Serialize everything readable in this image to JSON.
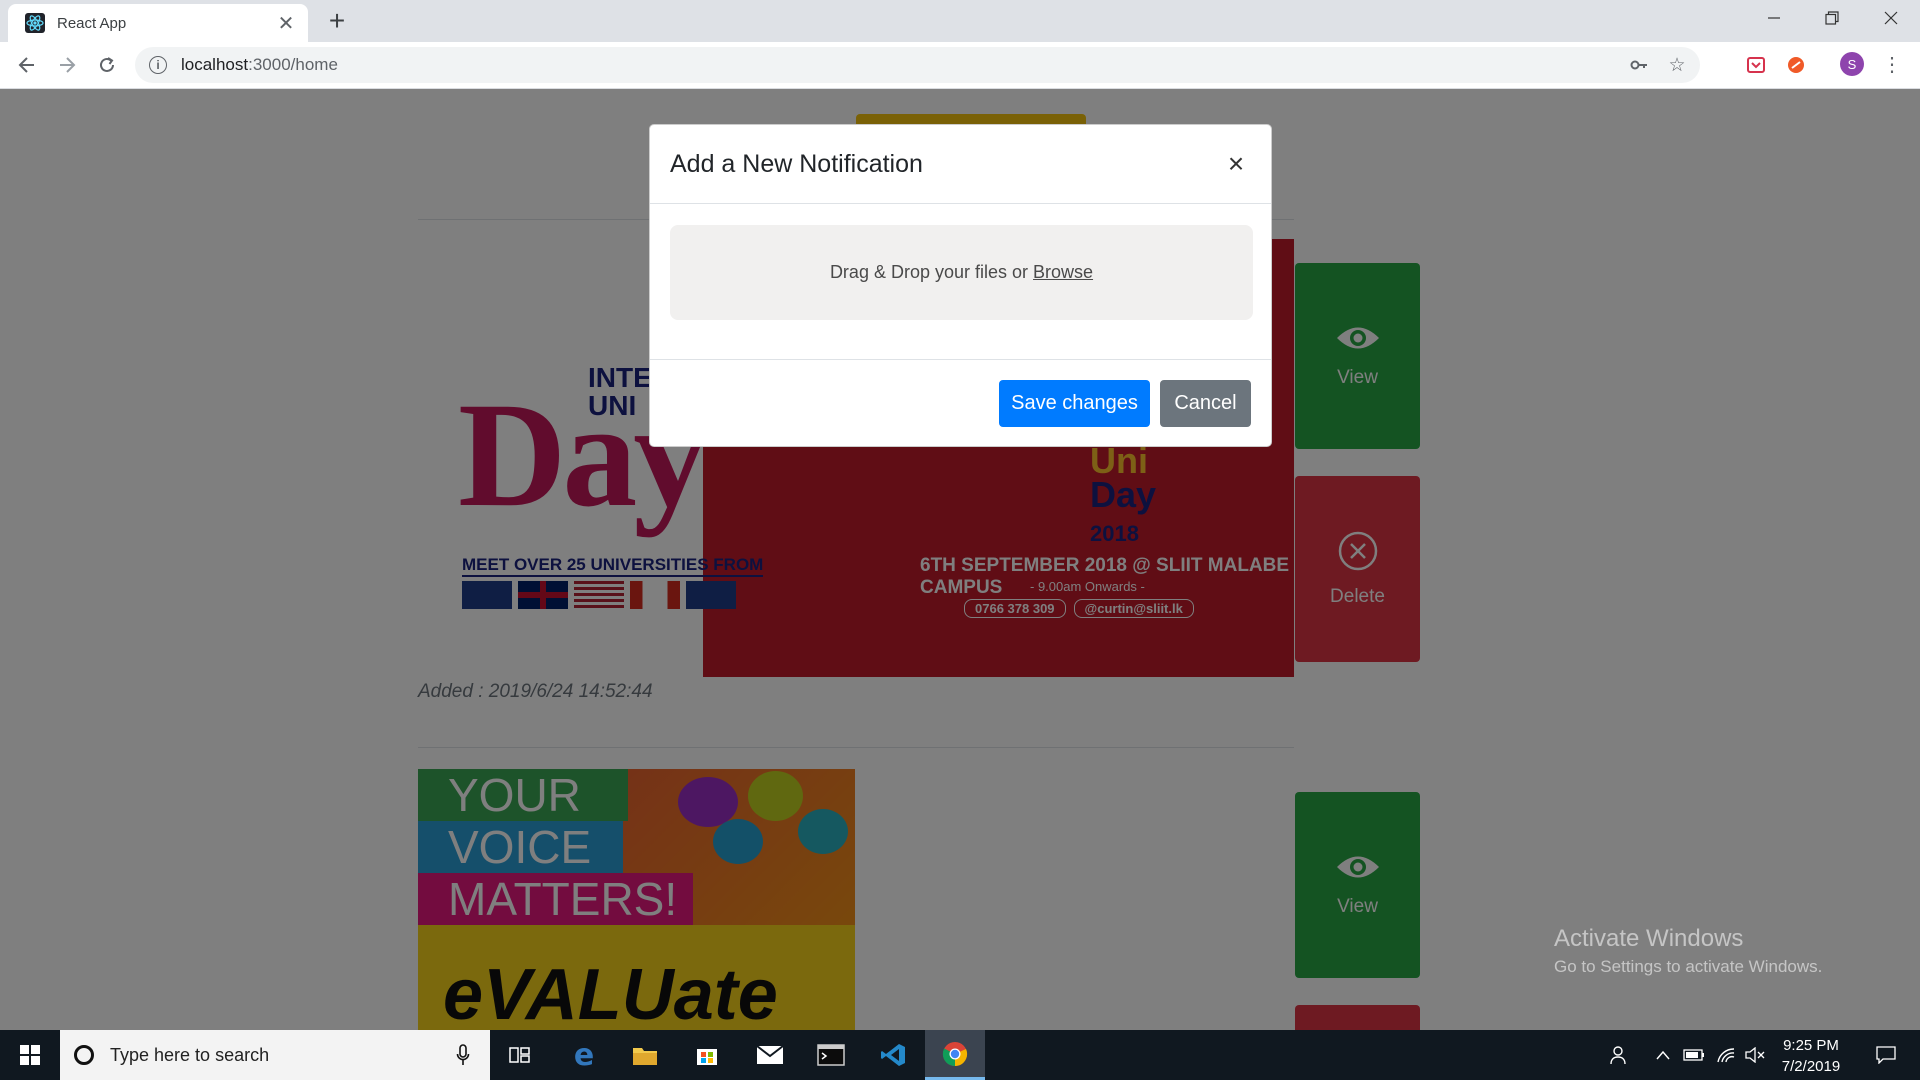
{
  "browser": {
    "tab_title": "React App",
    "url_host": "localhost",
    "url_path": ":3000/home",
    "avatar_letter": "S"
  },
  "page": {
    "poster1": {
      "inter_text": "INTER",
      "uni_text": "UNI",
      "day_text": "Day",
      "meet_text": "MEET OVER 25 UNIVERSITIES FROM",
      "countries": [
        "AUSTRALIA",
        "UK",
        "USA",
        "CANADA",
        "NEW ZEALAND"
      ],
      "uniday_line1": "Uni",
      "uniday_line2": "Day",
      "uniday_year": "2018",
      "date_text": "6TH SEPTEMBER 2018 @ SLIIT MALABE CAMPUS",
      "onwards_text": "- 9.00am Onwards -",
      "phone": "0766 378 309",
      "email": "@curtin@sliit.lk"
    },
    "added_text": "Added : 2019/6/24 14:52:44",
    "poster2": {
      "line1": "YOUR",
      "line2": "VOICE",
      "line3": "MATTERS!",
      "evaluate": "eVALUate"
    },
    "view_label": "View",
    "delete_label": "Delete"
  },
  "modal": {
    "title": "Add a New Notification",
    "close_symbol": "×",
    "dropzone_text": "Drag & Drop your files or",
    "browse_text": "Browse",
    "save_label": "Save changes",
    "cancel_label": "Cancel"
  },
  "watermark": {
    "line1": "Activate Windows",
    "line2": "Go to Settings to activate Windows."
  },
  "taskbar": {
    "search_placeholder": "Type here to search",
    "time": "9:25 PM",
    "date": "7/2/2019"
  },
  "colors": {
    "primary": "#007bff",
    "secondary": "#6c757d",
    "success": "#28a745",
    "danger": "#dc3545"
  },
  "icons": [
    "react-icon",
    "close-icon",
    "plus-icon",
    "back-icon",
    "forward-icon",
    "reload-icon",
    "info-icon",
    "key-icon",
    "star-icon",
    "pocket-icon",
    "extension-icon",
    "menu-icon",
    "eye-icon",
    "x-circle-icon",
    "windows-icon",
    "mic-icon",
    "task-view-icon",
    "edge-icon",
    "folder-icon",
    "store-icon",
    "mail-icon",
    "terminal-icon",
    "vscode-icon",
    "chrome-icon",
    "people-icon",
    "chevron-up-icon",
    "battery-icon",
    "wifi-icon",
    "volume-icon",
    "notification-icon"
  ]
}
